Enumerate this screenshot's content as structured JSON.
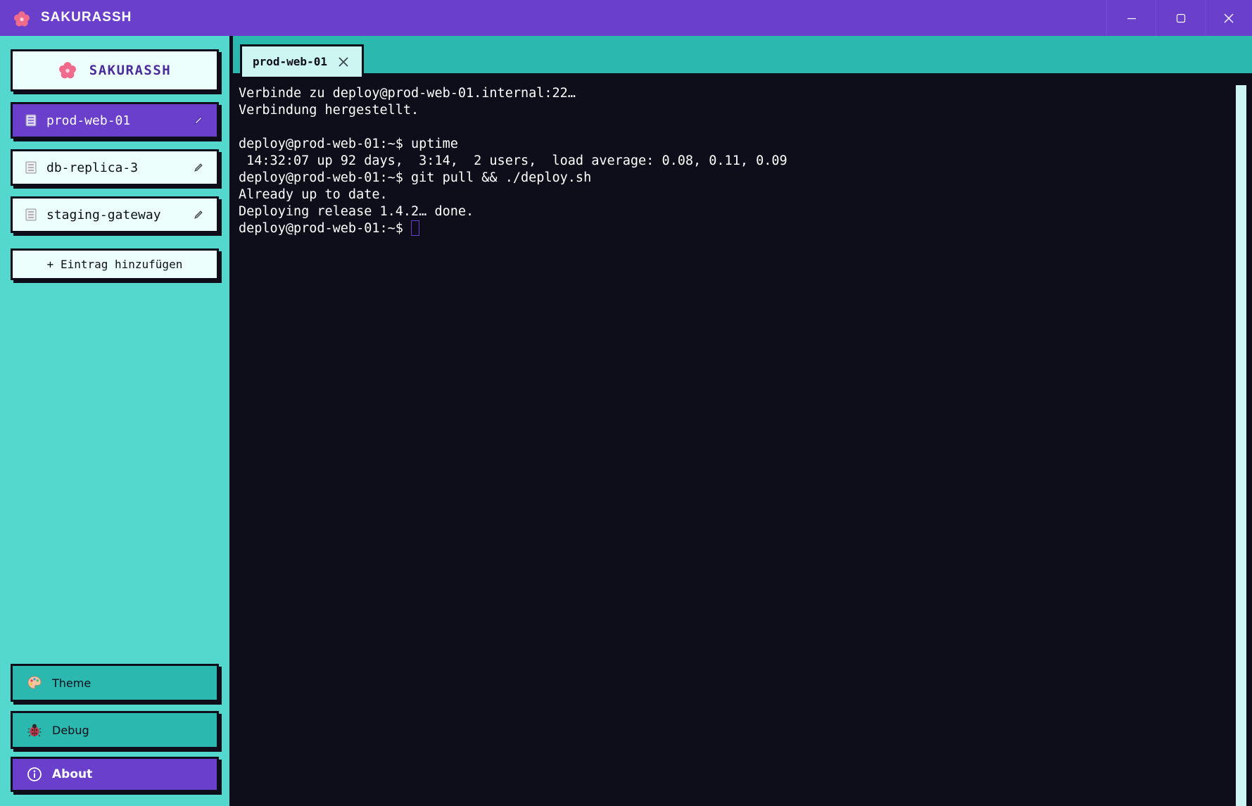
{
  "window": {
    "title": "SAKURASSH",
    "controls": [
      "minimize-icon",
      "maximize-icon",
      "close-icon"
    ]
  },
  "sidebar": {
    "brand": "SAKURASSH",
    "hosts": [
      {
        "label": "prod-web-01",
        "active": true
      },
      {
        "label": "db-replica-3",
        "active": false
      },
      {
        "label": "staging-gateway",
        "active": false
      }
    ],
    "add_entry": "+ Eintrag hinzufügen",
    "bottom": [
      {
        "label": "Theme",
        "icon": "palette-icon"
      },
      {
        "label": "Debug",
        "icon": "bug-icon"
      },
      {
        "label": "About",
        "icon": "info-icon"
      }
    ]
  },
  "tabs": [
    {
      "label": "prod-web-01"
    }
  ],
  "terminal": {
    "lines": [
      "Verbinde zu deploy@prod-web-01.internal:22…",
      "Verbindung hergestellt.",
      "",
      "deploy@prod-web-01:~$ uptime",
      " 14:32:07 up 92 days,  3:14,  2 users,  load average: 0.08, 0.11, 0.09",
      "deploy@prod-web-01:~$ git pull && ./deploy.sh",
      "Already up to date.",
      "Deploying release 1.4.2… done."
    ],
    "prompt": "deploy@prod-web-01:~$ "
  },
  "colors": {
    "titlebar": "#6a3fcb",
    "sidebar": "#54d8ce",
    "tabbar": "#2bb8ae",
    "terminal_bg": "#0d0e1a",
    "accent": "#6a3fcb",
    "sakura": "#f06a8c"
  }
}
